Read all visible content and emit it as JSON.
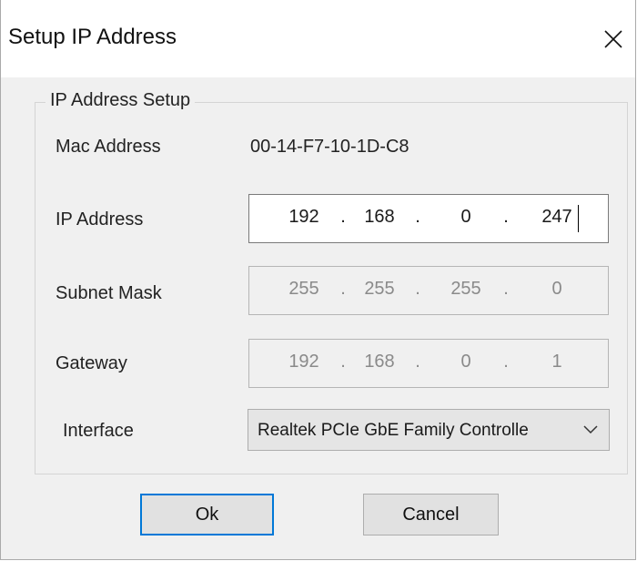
{
  "window": {
    "title": "Setup IP Address"
  },
  "group": {
    "title": "IP Address Setup"
  },
  "mac": {
    "label": "Mac Address",
    "value": "00-14-F7-10-1D-C8"
  },
  "ip": {
    "label": "IP Address",
    "octets": [
      "192",
      "168",
      "0",
      "247"
    ]
  },
  "subnet": {
    "label": "Subnet Mask",
    "octets": [
      "255",
      "255",
      "255",
      "0"
    ]
  },
  "gateway": {
    "label": "Gateway",
    "octets": [
      "192",
      "168",
      "0",
      "1"
    ]
  },
  "interface": {
    "label": "Interface",
    "selected": "Realtek PCIe GbE Family Controlle"
  },
  "buttons": {
    "ok": "Ok",
    "cancel": "Cancel"
  },
  "separator": "."
}
